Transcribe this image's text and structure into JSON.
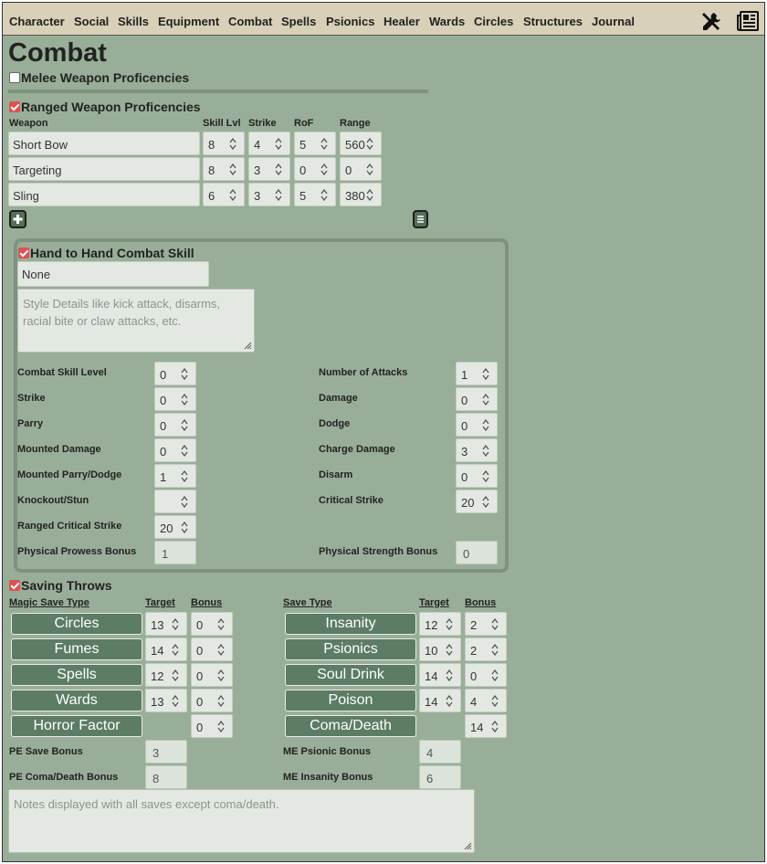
{
  "nav": {
    "items": [
      "Character",
      "Social",
      "Skills",
      "Equipment",
      "Combat",
      "Spells",
      "Psionics",
      "Healer",
      "Wards",
      "Circles",
      "Structures",
      "Journal"
    ],
    "tools_icon": "tools-icon",
    "sheet_icon": "newspaper-icon"
  },
  "page_title": "Combat",
  "melee": {
    "label": "Melee Weapon Proficencies",
    "checked": false
  },
  "ranged": {
    "label": "Ranged Weapon Proficencies",
    "checked": true,
    "headers": {
      "weapon": "Weapon",
      "skill": "Skill Lvl",
      "strike": "Strike",
      "rof": "RoF",
      "range": "Range"
    },
    "rows": [
      {
        "weapon": "Short Bow",
        "skill": "8",
        "strike": "4",
        "rof": "5",
        "range": "560"
      },
      {
        "weapon": "Targeting",
        "skill": "8",
        "strike": "3",
        "rof": "0",
        "range": "0"
      },
      {
        "weapon": "Sling",
        "skill": "6",
        "strike": "3",
        "rof": "5",
        "range": "380"
      }
    ],
    "add_icon": "plus-icon",
    "menu_icon": "list-icon"
  },
  "h2h": {
    "label": "Hand to Hand Combat Skill",
    "checked": true,
    "style_value": "None",
    "details_placeholder": "Style Details like kick attack, disarms, racial bite or claw attacks, etc.",
    "left": [
      {
        "label": "Combat Skill Level",
        "value": "0"
      },
      {
        "label": "Strike",
        "value": "0"
      },
      {
        "label": "Parry",
        "value": "0"
      },
      {
        "label": "Mounted Damage",
        "value": "0"
      },
      {
        "label": "Mounted Parry/Dodge",
        "value": "1"
      },
      {
        "label": "Knockout/Stun",
        "value": ""
      },
      {
        "label": "Ranged Critical Strike",
        "value": "20"
      }
    ],
    "right": [
      {
        "label": "Number of Attacks",
        "value": "1"
      },
      {
        "label": "Damage",
        "value": "0"
      },
      {
        "label": "Dodge",
        "value": "0"
      },
      {
        "label": "Charge Damage",
        "value": "3"
      },
      {
        "label": "Disarm",
        "value": "0"
      },
      {
        "label": "Critical Strike",
        "value": "20"
      }
    ],
    "prowess": {
      "label": "Physical Prowess Bonus",
      "value": "1"
    },
    "strength": {
      "label": "Physical Strength Bonus",
      "value": "0"
    }
  },
  "saves": {
    "label": "Saving Throws",
    "checked": true,
    "magic_header": "Magic Save Type",
    "save_header": "Save Type",
    "target_header": "Target",
    "bonus_header": "Bonus",
    "magic": [
      {
        "name": "Circles",
        "target": "13",
        "bonus": "0"
      },
      {
        "name": "Fumes",
        "target": "14",
        "bonus": "0"
      },
      {
        "name": "Spells",
        "target": "12",
        "bonus": "0"
      },
      {
        "name": "Wards",
        "target": "13",
        "bonus": "0"
      },
      {
        "name": "Horror Factor",
        "bonus": "0"
      }
    ],
    "other": [
      {
        "name": "Insanity",
        "target": "12",
        "bonus": "2"
      },
      {
        "name": "Psionics",
        "target": "10",
        "bonus": "2"
      },
      {
        "name": "Soul Drink",
        "target": "14",
        "bonus": "0"
      },
      {
        "name": "Poison",
        "target": "14",
        "bonus": "4"
      },
      {
        "name": "Coma/Death",
        "bonus": "14"
      }
    ],
    "pe_save": {
      "label": "PE Save Bonus",
      "value": "3"
    },
    "pe_coma": {
      "label": "PE Coma/Death Bonus",
      "value": "8"
    },
    "me_psionic": {
      "label": "ME Psionic Bonus",
      "value": "4"
    },
    "me_insanity": {
      "label": "ME Insanity Bonus",
      "value": "6"
    },
    "notes_placeholder": "Notes displayed with all saves except coma/death."
  },
  "colors": {
    "bg": "#99ae98",
    "nav": "#d8d0b8",
    "button": "#5c7c64",
    "check": "#e05050"
  }
}
